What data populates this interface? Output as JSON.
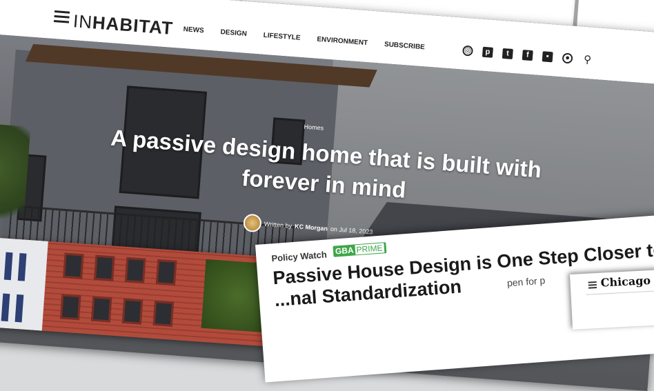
{
  "main_site": {
    "logo_in": "IN",
    "logo_rest": "HABITAT",
    "nav": [
      "NEWS",
      "DESIGN",
      "LIFESTYLE",
      "ENVIRONMENT",
      "SUBSCRIBE"
    ],
    "social_icons": [
      "instagram-icon",
      "pinterest-icon",
      "twitter-icon",
      "facebook-icon",
      "flipboard-icon",
      "user-icon",
      "search-icon"
    ],
    "category": "Homes",
    "headline": "A passive design home that is built with forever in mind",
    "byline": {
      "prefix": "Written by",
      "author": "KC Morgan",
      "on": "on",
      "date": "Jul 18, 2023"
    }
  },
  "gba_card": {
    "section": "Policy Watch",
    "badge_main": "GBA",
    "badge_sub": "PRIME",
    "title": "Passive House Design is One Step Closer to ...nal Standardization",
    "snippet": "pen for p"
  },
  "chicago_card": {
    "name": "Chicago Trib"
  },
  "colors": {
    "gba_green": "#3fa64a",
    "dark_text": "#222222"
  }
}
